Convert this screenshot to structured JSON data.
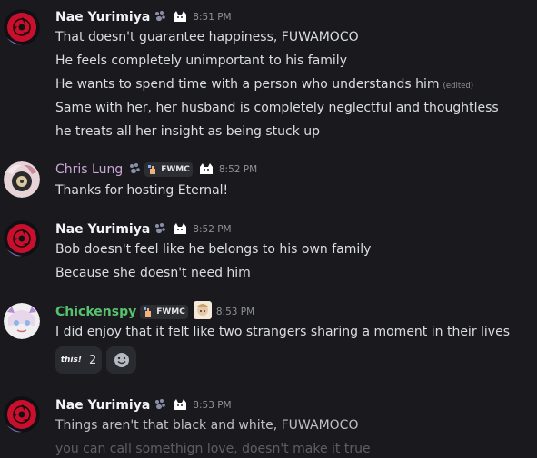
{
  "messages": [
    {
      "author": "Nae Yurimiya",
      "time": "8:51 PM",
      "color": "#f2f3f5",
      "lines": [
        "That doesn't guarantee happiness, FUWAMOCO",
        "He feels completely unimportant to his family",
        "He wants to spend time with a person who understands him",
        "Same with her, her husband is completely neglectful and thoughtless",
        "he treats all her insight as being stuck up"
      ],
      "edited_label": "(edited)"
    },
    {
      "author": "Chris Lung",
      "time": "8:52 PM",
      "color": "#c9a6d8",
      "badge": "FWMC",
      "lines": [
        "Thanks for hosting Eternal!"
      ]
    },
    {
      "author": "Nae Yurimiya",
      "time": "8:52 PM",
      "color": "#f2f3f5",
      "lines": [
        "Bob doesn't feel like he belongs to his own family",
        "Because she doesn't need him"
      ]
    },
    {
      "author": "Chickenspy",
      "time": "8:53 PM",
      "color": "#57c26e",
      "badge": "FWMC",
      "lines": [
        "I did enjoy that it felt like two strangers sharing a moment in their lives"
      ],
      "reaction": {
        "emoji_text": "this!",
        "count": "2",
        "add_icon": "add-reaction-icon"
      }
    },
    {
      "author": "Nae Yurimiya",
      "time": "8:53 PM",
      "color": "#f2f3f5",
      "lines": [
        "Things aren't that black and white, FUWAMOCO",
        "you can call somethign love, doesn't make it true"
      ]
    }
  ]
}
